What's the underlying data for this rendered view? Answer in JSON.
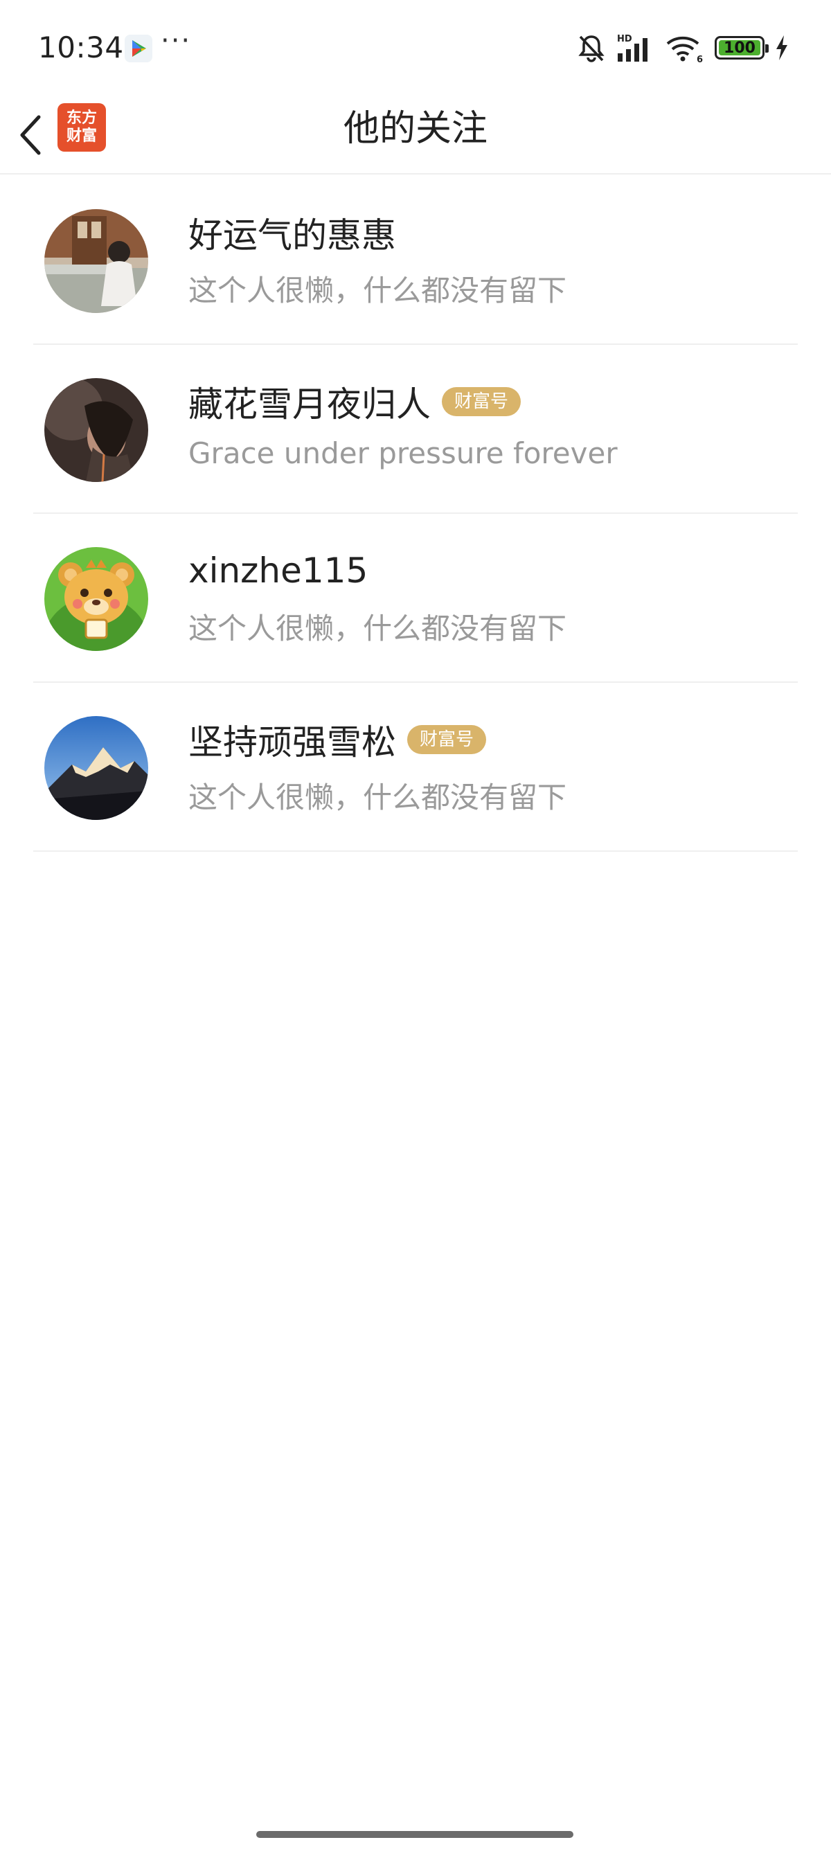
{
  "status_bar": {
    "time": "10:34",
    "more": "···",
    "battery": "100",
    "icons": [
      "google-play-icon",
      "bell-mute-icon",
      "hd-signal-icon",
      "wifi-6-icon",
      "battery-icon",
      "charging-icon"
    ]
  },
  "header": {
    "back_icon": "chevron-left-icon",
    "logo_line1": "东方",
    "logo_line2": "财富",
    "title": "他的关注"
  },
  "following": [
    {
      "name": "好运气的惠惠",
      "badge": "",
      "bio": "这个人很懒，什么都没有留下"
    },
    {
      "name": "藏花雪月夜归人",
      "badge": "财富号",
      "bio": "Grace under pressure forever"
    },
    {
      "name": "xinzhe115",
      "badge": "",
      "bio": "这个人很懒，什么都没有留下"
    },
    {
      "name": "坚持顽强雪松",
      "badge": "财富号",
      "bio": "这个人很懒，什么都没有留下"
    }
  ],
  "colors": {
    "badge": "#d9b46a",
    "logo": "#e5502b",
    "bio_text": "#9a9a9a",
    "battery_fill": "#4caf2e"
  }
}
